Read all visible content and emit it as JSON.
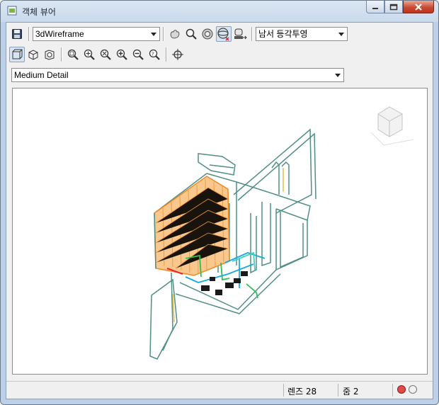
{
  "window": {
    "title": "객체 뷰어"
  },
  "toolbar": {
    "save_icon": "save-icon",
    "visual_style": "3dWireframe",
    "view_direction": "남서 등각투영"
  },
  "detail": {
    "selected": "Medium Detail"
  },
  "status": {
    "lens": "렌즈 28",
    "zoom": "줌 2",
    "light_red_color": "#e24a4a",
    "light_gray_color": "#f2f2f2"
  },
  "colors": {
    "accent_orange": "#f08a24",
    "wire_teal": "#4f8f88",
    "wire_cyan": "#1aa9e0",
    "wire_green": "#2fbf4f"
  }
}
